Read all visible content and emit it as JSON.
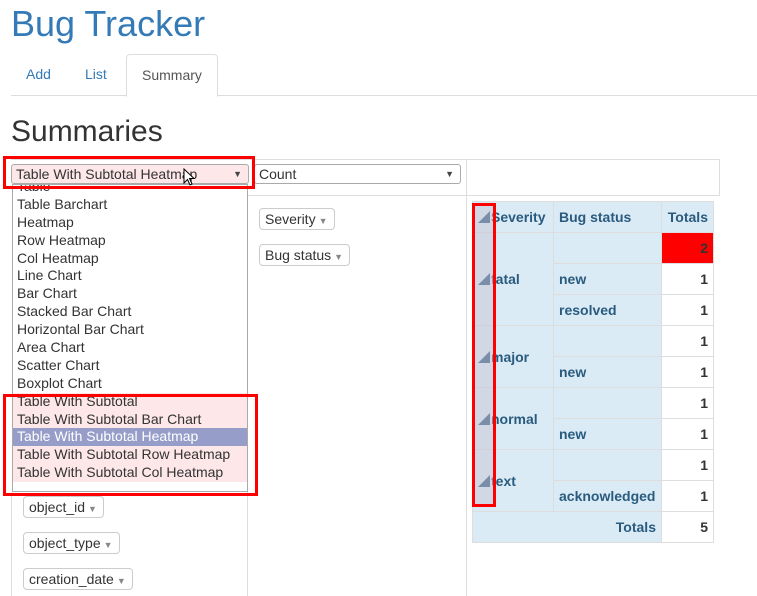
{
  "app": {
    "title": "Bug Tracker"
  },
  "tabs": [
    {
      "label": "Add",
      "active": false
    },
    {
      "label": "List",
      "active": false
    },
    {
      "label": "Summary",
      "active": true
    }
  ],
  "page": {
    "section_title": "Summaries"
  },
  "renderer": {
    "selected": "Table With Subtotal Heatmap",
    "options": [
      "Table",
      "Table Barchart",
      "Heatmap",
      "Row Heatmap",
      "Col Heatmap",
      "Line Chart",
      "Bar Chart",
      "Stacked Bar Chart",
      "Horizontal Bar Chart",
      "Area Chart",
      "Scatter Chart",
      "Boxplot Chart",
      "Table With Subtotal",
      "Table With Subtotal Bar Chart",
      "Table With Subtotal Heatmap",
      "Table With Subtotal Row Heatmap",
      "Table With Subtotal Col Heatmap"
    ]
  },
  "aggregator": {
    "selected": "Count"
  },
  "row_fields": [
    "Severity",
    "Bug status"
  ],
  "unused_fields": [
    "object_id",
    "object_type",
    "creation_date"
  ],
  "pivot": {
    "headers": {
      "severity": "Severity",
      "bug_status": "Bug status",
      "totals": "Totals"
    },
    "groups": [
      {
        "severity": "fatal",
        "subtotal": "2",
        "rows": [
          {
            "status": "new",
            "value": "1"
          },
          {
            "status": "resolved",
            "value": "1"
          }
        ]
      },
      {
        "severity": "major",
        "subtotal": "1",
        "rows": [
          {
            "status": "new",
            "value": "1"
          }
        ]
      },
      {
        "severity": "normal",
        "subtotal": "1",
        "rows": [
          {
            "status": "new",
            "value": "1"
          }
        ]
      },
      {
        "severity": "text",
        "subtotal": "1",
        "rows": [
          {
            "status": "acknowledged",
            "value": "1"
          }
        ]
      }
    ],
    "totals_label": "Totals",
    "grand_total": "5",
    "heat_color": "#ff0000"
  }
}
